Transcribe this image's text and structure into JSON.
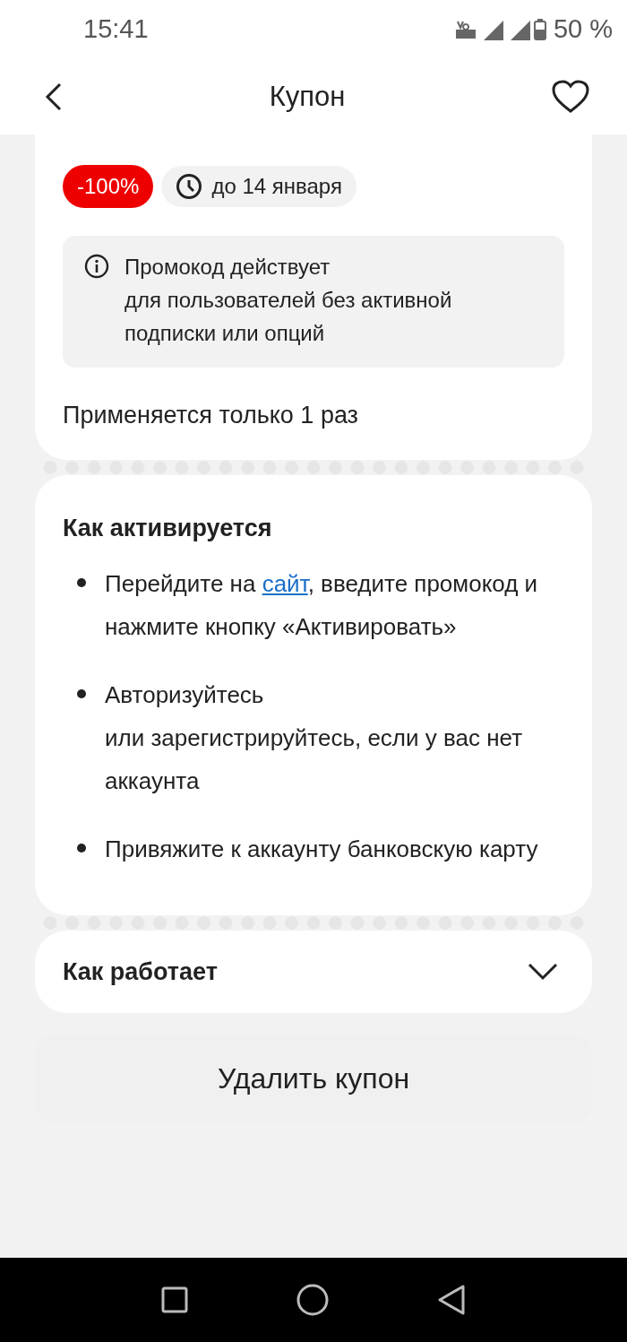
{
  "status_bar": {
    "time": "15:41",
    "battery": "50 %"
  },
  "header": {
    "title": "Купон"
  },
  "coupon": {
    "discount": "-100%",
    "expiry": "до 14 января",
    "notice": "Промокод действует\nдля пользователей без активной\nподписки или опций",
    "usage": "Применяется только 1 раз"
  },
  "activation": {
    "title": "Как активируется",
    "steps": [
      {
        "before": "Перейдите на ",
        "link": "сайт",
        "after": ", введите промокод и нажмите кнопку «Активировать»"
      },
      {
        "before": "Авторизуйтесь\nили зарегистрируйтесь, если у вас нет аккаунта"
      },
      {
        "before": "Привяжите к аккаунту банковскую карту"
      }
    ]
  },
  "how_it_works": {
    "title": "Как работает",
    "expanded": false
  },
  "delete_button": "Удалить купон"
}
